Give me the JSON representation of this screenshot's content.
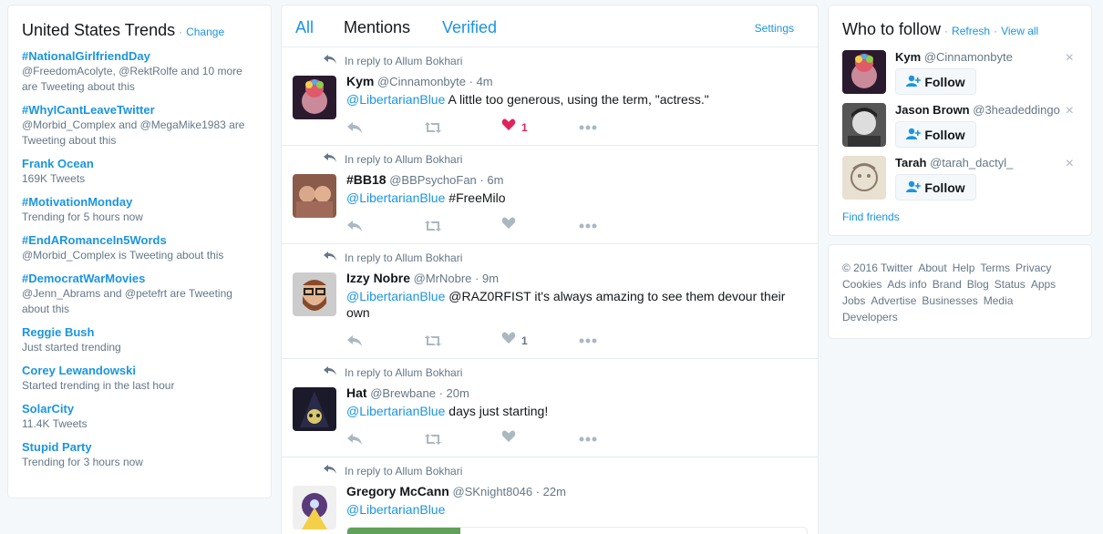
{
  "trends": {
    "title": "United States Trends",
    "sep": "·",
    "change": "Change",
    "items": [
      {
        "name": "#NationalGirlfriendDay",
        "meta": "@FreedomAcolyte, @RektRolfe and 10 more are Tweeting about this"
      },
      {
        "name": "#WhyICantLeaveTwitter",
        "meta": "@Morbid_Complex and @MegaMike1983 are Tweeting about this"
      },
      {
        "name": "Frank Ocean",
        "meta": "169K Tweets"
      },
      {
        "name": "#MotivationMonday",
        "meta": "Trending for 5 hours now"
      },
      {
        "name": "#EndARomanceIn5Words",
        "meta": "@Morbid_Complex is Tweeting about this"
      },
      {
        "name": "#DemocratWarMovies",
        "meta": "@Jenn_Abrams and @petefrt are Tweeting about this"
      },
      {
        "name": "Reggie Bush",
        "meta": "Just started trending"
      },
      {
        "name": "Corey Lewandowski",
        "meta": "Started trending in the last hour"
      },
      {
        "name": "SolarCity",
        "meta": "11.4K Tweets"
      },
      {
        "name": "Stupid Party",
        "meta": "Trending for 3 hours now"
      }
    ]
  },
  "timeline": {
    "tabs": [
      "All",
      "Mentions",
      "Verified"
    ],
    "active_tab": "Mentions",
    "settings": "Settings",
    "tweets": [
      {
        "reply_to": "In reply to Allum Bokhari",
        "name": "Kym",
        "handle": "@Cinnamonbyte",
        "time": "· 4m",
        "mention": "@LibertarianBlue",
        "text": " A little too generous, using the term, \"actress.\"",
        "likes": "1",
        "liked": true
      },
      {
        "reply_to": "In reply to Allum Bokhari",
        "name": "#BB18",
        "handle": "@BBPsychoFan",
        "time": "· 6m",
        "mention": "@LibertarianBlue",
        "text": " #FreeMilo",
        "likes": "",
        "liked": false
      },
      {
        "reply_to": "In reply to Allum Bokhari",
        "name": "Izzy Nobre",
        "handle": "@MrNobre",
        "time": "· 9m",
        "mention": "@LibertarianBlue",
        "text": " @RAZ0RFIST it's always amazing to see them devour their own",
        "likes": "1",
        "liked": false
      },
      {
        "reply_to": "In reply to Allum Bokhari",
        "name": "Hat",
        "handle": "@Brewbane",
        "time": "· 20m",
        "mention": "@LibertarianBlue",
        "text": " days just starting!",
        "likes": "",
        "liked": false
      },
      {
        "reply_to": "In reply to Allum Bokhari",
        "name": "Gregory McCann",
        "handle": "@SKnight8046",
        "time": "· 22m",
        "mention": "@LibertarianBlue",
        "text": "",
        "likes": "",
        "liked": false
      }
    ]
  },
  "who_to_follow": {
    "title": "Who to follow",
    "sep": "·",
    "refresh": "Refresh",
    "view_all": "View all",
    "follow_label": "Follow",
    "close_glyph": "×",
    "users": [
      {
        "name": "Kym",
        "handle": "@Cinnamonbyte"
      },
      {
        "name": "Jason Brown",
        "handle": "@3headeddingo"
      },
      {
        "name": "Tarah",
        "handle": "@tarah_dactyl_"
      }
    ],
    "find_friends": "Find friends"
  },
  "footer": {
    "links": [
      "© 2016 Twitter",
      "About",
      "Help",
      "Terms",
      "Privacy",
      "Cookies",
      "Ads info",
      "Brand",
      "Blog",
      "Status",
      "Apps",
      "Jobs",
      "Advertise",
      "Businesses",
      "Media",
      "Developers"
    ]
  },
  "colors": {
    "link": "#1b95e0",
    "like": "#e0245e",
    "meta": "#657786",
    "icon": "#aab8c2"
  }
}
